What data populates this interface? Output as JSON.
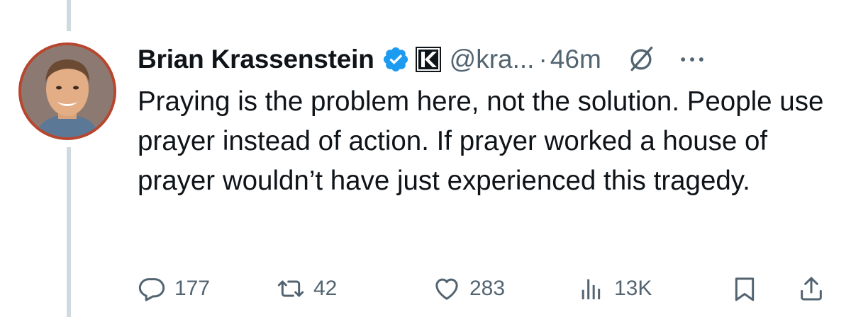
{
  "author": {
    "display_name": "Brian Krassenstein",
    "handle": "@kra...",
    "separator": "·",
    "timestamp": "46m"
  },
  "tweet": {
    "text": "Praying is the problem here, not the solution. People use prayer instead of action. If prayer worked a house of prayer wouldn’t have just experienced this tragedy."
  },
  "actions": {
    "replies": "177",
    "reposts": "42",
    "likes": "283",
    "views": "13K"
  },
  "icons": {
    "verified": "verified-badge-icon",
    "affiliate": "affiliate-k-icon",
    "grok": "grok-icon",
    "more": "more-horizontal-icon",
    "reply": "reply-icon",
    "repost": "repost-icon",
    "like": "heart-icon",
    "views": "analytics-icon",
    "bookmark": "bookmark-icon",
    "share": "share-icon"
  },
  "colors": {
    "text_primary": "#0f1419",
    "text_secondary": "#536471",
    "verified_blue": "#1d9bf0",
    "thread_line": "#cfd9de",
    "avatar_ring": "#b7462f"
  }
}
